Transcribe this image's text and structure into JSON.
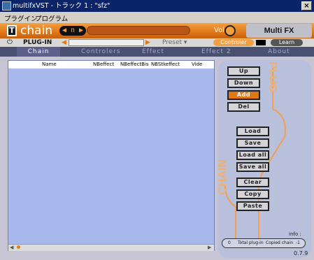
{
  "window": {
    "title": "multifxVST - トラック 1 : \"sfz\"",
    "close": "×"
  },
  "menu": {
    "items": [
      "プラグイン",
      "プログラム"
    ]
  },
  "header": {
    "title": "chain",
    "program_display": "◀ n ▶",
    "vol_label": "Vol",
    "brand": "Multi FX"
  },
  "plugin_row": {
    "label": "PLUG-IN",
    "preset": "Preset ▾",
    "controller": "Controler",
    "learn": "Learn"
  },
  "tabs": [
    "Chain",
    "Controlers",
    "Effect",
    "Effect 2",
    "About"
  ],
  "list": {
    "columns": [
      "Name",
      "NBeffect",
      "NBeffectBis",
      "NBStkeffect",
      "Vide"
    ]
  },
  "buttons": {
    "up": "Up",
    "down": "Down",
    "add": "Add",
    "del": "Del",
    "load": "Load",
    "save": "Save",
    "load_all": "Load all",
    "save_all": "Save all",
    "clear": "Clear",
    "copy": "Copy",
    "paste": "Paste"
  },
  "panel_labels": {
    "plug": "PLUG",
    "chain": "CHAIN"
  },
  "info": {
    "label": "info :",
    "count": "0",
    "total_label": "Total plug-in",
    "copied_label": "Copied chain",
    "copied_value": "-1"
  },
  "version": "0.7.9",
  "colors": {
    "accent": "#e07818",
    "list_bg": "#a9b8ec",
    "panel_bg": "#b8c0dc"
  }
}
